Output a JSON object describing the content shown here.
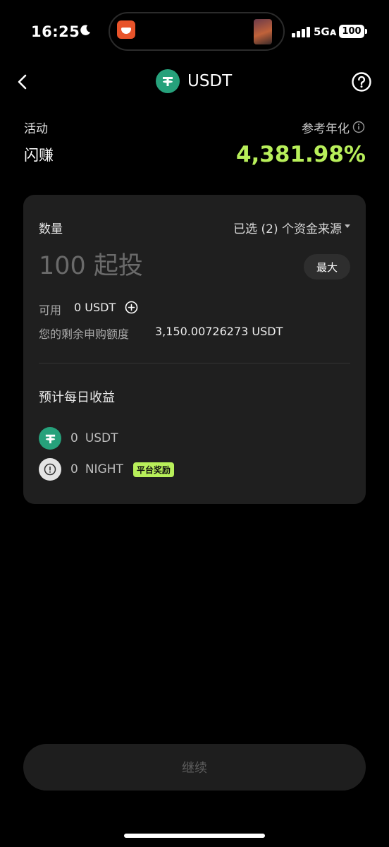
{
  "status_bar": {
    "time": "16:25",
    "network": "5Gᴀ",
    "battery": "100"
  },
  "header": {
    "title": "USDT",
    "token_icon": "tether-icon"
  },
  "activity": {
    "label": "活动",
    "value": "闪赚",
    "apy_label": "参考年化",
    "apy_value": "4,381.98%",
    "apy_color": "#b8ef5a"
  },
  "form": {
    "quantity_label": "数量",
    "source_selector": "已选 (2) 个资金来源",
    "amount_placeholder": "100 起投",
    "max_label": "最大",
    "available_label": "可用",
    "available_value": "0 USDT",
    "remaining_label": "您的剩余申购额度",
    "remaining_value": "3,150.00726273 USDT"
  },
  "earnings": {
    "title": "预计每日收益",
    "items": [
      {
        "amount": "0",
        "currency": "USDT",
        "icon": "tether-icon"
      },
      {
        "amount": "0",
        "currency": "NIGHT",
        "icon": "night-token-icon",
        "badge": "平台奖励"
      }
    ]
  },
  "footer": {
    "continue_label": "继续"
  }
}
